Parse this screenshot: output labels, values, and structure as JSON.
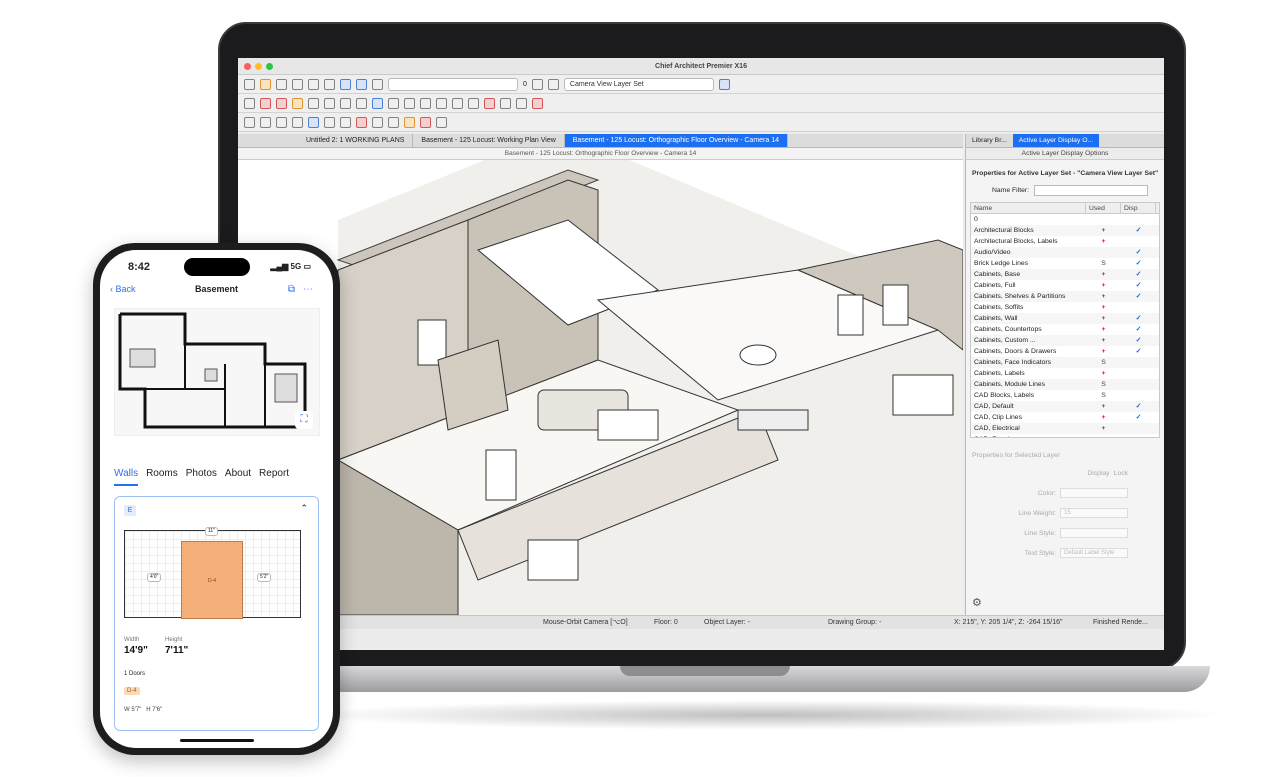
{
  "app": {
    "window_title": "Chief Architect Premier X16",
    "layer_set_combo": "Camera View Layer Set",
    "zoom_value": "0",
    "tabs": [
      {
        "label": "Untitled 2: 1 WORKING PLANS",
        "active": false
      },
      {
        "label": "Basement - 125 Locust: Working Plan View",
        "active": false
      },
      {
        "label": "Basement - 125 Locust: Orthographic Floor Overview - Camera 14",
        "active": true
      }
    ],
    "view_caption": "Basement - 125 Locust: Orthographic Floor Overview - Camera 14",
    "status": {
      "mode": "Mouse-Orbit Camera [⌥O]",
      "floor": "Floor: 0",
      "object_layer": "Object Layer: -",
      "drawing_group": "Drawing Group: -",
      "coords": "X: 215\", Y: 205 1/4\", Z: -264 15/16\"",
      "render": "Finished Rende..."
    },
    "panel": {
      "tabs": [
        "Library Br...",
        "Active Layer Display O..."
      ],
      "header": "Active Layer Display Options",
      "props_title": "Properties for Active Layer Set - \"Camera View Layer Set\"",
      "name_filter_label": "Name Filter:",
      "columns": [
        "Name",
        "Used",
        "Disp"
      ],
      "layers": [
        {
          "name": "0",
          "used": "",
          "disp": ""
        },
        {
          "name": "Architectural Blocks",
          "used": "+",
          "disp": "✓"
        },
        {
          "name": "Architectural Blocks, Labels",
          "used": "+",
          "disp": ""
        },
        {
          "name": "Audio/Video",
          "used": "",
          "disp": "✓"
        },
        {
          "name": "Brick Ledge Lines",
          "used": "S",
          "disp": "✓"
        },
        {
          "name": "Cabinets, Base",
          "used": "+",
          "disp": "✓"
        },
        {
          "name": "Cabinets, Full",
          "used": "+",
          "disp": "✓"
        },
        {
          "name": "Cabinets, Shelves & Partitions",
          "used": "+",
          "disp": "✓"
        },
        {
          "name": "Cabinets, Soffits",
          "used": "+",
          "disp": ""
        },
        {
          "name": "Cabinets, Wall",
          "used": "+",
          "disp": "✓"
        },
        {
          "name": "Cabinets, Countertops",
          "used": "+",
          "disp": "✓"
        },
        {
          "name": "Cabinets, Custom ...",
          "used": "+",
          "disp": "✓"
        },
        {
          "name": "Cabinets, Doors & Drawers",
          "used": "+",
          "disp": "✓"
        },
        {
          "name": "Cabinets, Face Indicators",
          "used": "S",
          "disp": ""
        },
        {
          "name": "Cabinets, Labels",
          "used": "+",
          "disp": ""
        },
        {
          "name": "Cabinets, Module Lines",
          "used": "S",
          "disp": ""
        },
        {
          "name": "CAD Blocks, Labels",
          "used": "S",
          "disp": ""
        },
        {
          "name": "CAD, Default",
          "used": "+",
          "disp": "✓"
        },
        {
          "name": "CAD, Clip Lines",
          "used": "+",
          "disp": "✓"
        },
        {
          "name": "CAD, Electrical",
          "used": "+",
          "disp": ""
        },
        {
          "name": "CAD, Framing",
          "used": "+",
          "disp": ""
        }
      ],
      "selected_title": "Properties for Selected Layer",
      "display_label": "Display",
      "lock_label": "Lock",
      "color_label": "Color:",
      "line_weight_label": "Line Weight:",
      "line_weight_value": "15",
      "line_style_label": "Line Style:",
      "text_style_label": "Text Style:",
      "text_style_value": "Default Label Style"
    }
  },
  "phone": {
    "time": "8:42",
    "status_right": "5G",
    "back_label": "Back",
    "title": "Basement",
    "tabs": [
      "Walls",
      "Rooms",
      "Photos",
      "About",
      "Report"
    ],
    "active_tab": "Walls",
    "wall_badge": "E",
    "dims": {
      "top": "11\"",
      "left": "4'0\"",
      "right": "5'2\""
    },
    "door_label": "D-4",
    "width_label": "Width",
    "width_value": "14'9\"",
    "height_label": "Height",
    "height_value": "7'11\"",
    "doors_count": "1 Doors",
    "door_chip": "D-4",
    "door_dims": "W 5'7\"   H 7'6\""
  }
}
